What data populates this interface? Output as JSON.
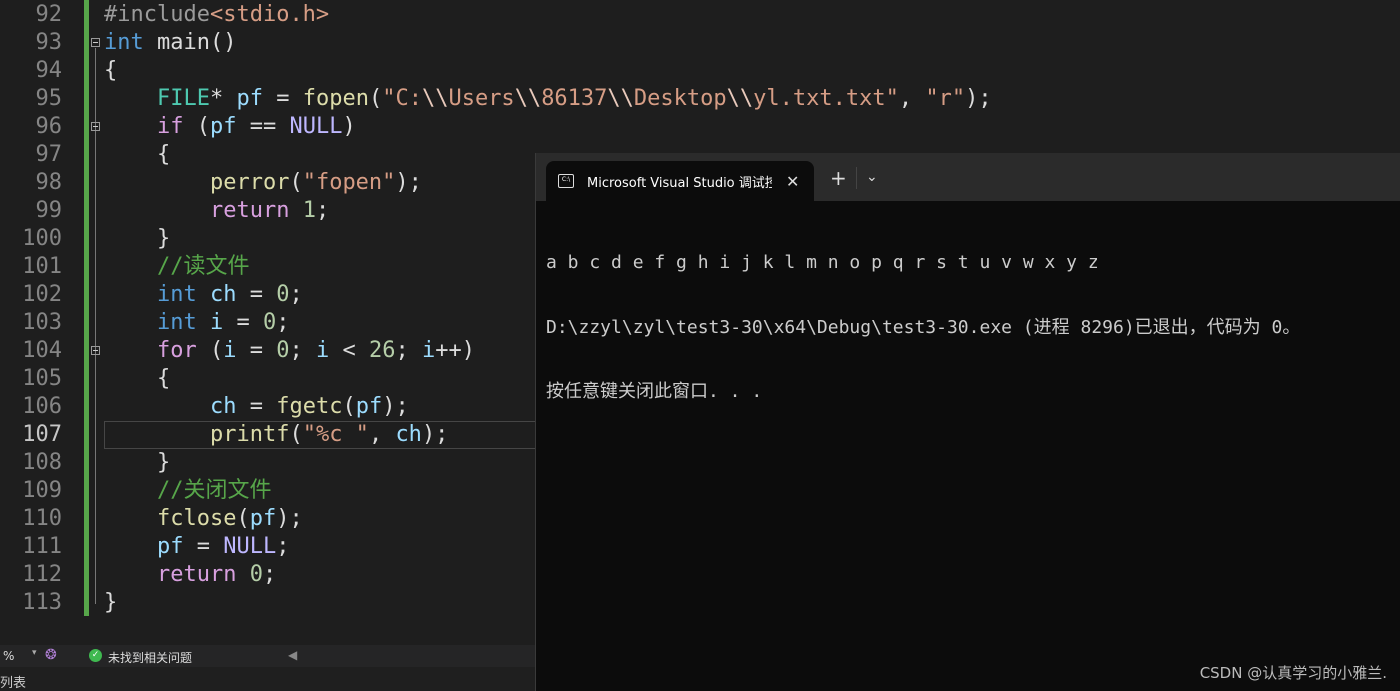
{
  "editor": {
    "current_line": 107,
    "lines": [
      {
        "n": 92,
        "tokens": [
          [
            "#include",
            "pp"
          ],
          [
            "<stdio.h>",
            "str"
          ]
        ]
      },
      {
        "n": 93,
        "tokens": [
          [
            "int",
            "kw"
          ],
          [
            " main()",
            ""
          ]
        ]
      },
      {
        "n": 94,
        "tokens": [
          [
            "{",
            ""
          ]
        ]
      },
      {
        "n": 95,
        "tokens": [
          [
            "    ",
            ""
          ],
          [
            "FILE",
            "ty"
          ],
          [
            "* ",
            ""
          ],
          [
            "pf",
            "var"
          ],
          [
            " = ",
            ""
          ],
          [
            "fopen",
            "fn"
          ],
          [
            "(",
            ""
          ],
          [
            "\"C:",
            "str"
          ],
          [
            "\\\\",
            "esc"
          ],
          [
            "Users",
            "str"
          ],
          [
            "\\\\",
            "esc"
          ],
          [
            "86137",
            "str"
          ],
          [
            "\\\\",
            "esc"
          ],
          [
            "Desktop",
            "str"
          ],
          [
            "\\\\",
            "esc"
          ],
          [
            "yl.txt.txt\"",
            "str"
          ],
          [
            ", ",
            ""
          ],
          [
            "\"r\"",
            "str"
          ],
          [
            ");",
            ""
          ]
        ]
      },
      {
        "n": 96,
        "tokens": [
          [
            "    ",
            ""
          ],
          [
            "if",
            "ctl"
          ],
          [
            " (",
            ""
          ],
          [
            "pf",
            "var"
          ],
          [
            " == ",
            ""
          ],
          [
            "NULL",
            "mac"
          ],
          [
            ")",
            ""
          ]
        ]
      },
      {
        "n": 97,
        "tokens": [
          [
            "    {",
            ""
          ]
        ]
      },
      {
        "n": 98,
        "tokens": [
          [
            "        ",
            ""
          ],
          [
            "perror",
            "fn"
          ],
          [
            "(",
            ""
          ],
          [
            "\"fopen\"",
            "str"
          ],
          [
            ");",
            ""
          ]
        ]
      },
      {
        "n": 99,
        "tokens": [
          [
            "        ",
            ""
          ],
          [
            "return",
            "ctl"
          ],
          [
            " ",
            ""
          ],
          [
            "1",
            "num"
          ],
          [
            ";",
            ""
          ]
        ]
      },
      {
        "n": 100,
        "tokens": [
          [
            "    }",
            ""
          ]
        ]
      },
      {
        "n": 101,
        "tokens": [
          [
            "    ",
            ""
          ],
          [
            "//读文件",
            "cm"
          ]
        ]
      },
      {
        "n": 102,
        "tokens": [
          [
            "    ",
            ""
          ],
          [
            "int",
            "kw"
          ],
          [
            " ",
            ""
          ],
          [
            "ch",
            "var"
          ],
          [
            " = ",
            ""
          ],
          [
            "0",
            "num"
          ],
          [
            ";",
            ""
          ]
        ]
      },
      {
        "n": 103,
        "tokens": [
          [
            "    ",
            ""
          ],
          [
            "int",
            "kw"
          ],
          [
            " ",
            ""
          ],
          [
            "i",
            "var"
          ],
          [
            " = ",
            ""
          ],
          [
            "0",
            "num"
          ],
          [
            ";",
            ""
          ]
        ]
      },
      {
        "n": 104,
        "tokens": [
          [
            "    ",
            ""
          ],
          [
            "for",
            "ctl"
          ],
          [
            " (",
            ""
          ],
          [
            "i",
            "var"
          ],
          [
            " = ",
            ""
          ],
          [
            "0",
            "num"
          ],
          [
            "; ",
            ""
          ],
          [
            "i",
            "var"
          ],
          [
            " < ",
            ""
          ],
          [
            "26",
            "num"
          ],
          [
            "; ",
            ""
          ],
          [
            "i",
            "var"
          ],
          [
            "++)",
            ""
          ]
        ]
      },
      {
        "n": 105,
        "tokens": [
          [
            "    {",
            ""
          ]
        ]
      },
      {
        "n": 106,
        "tokens": [
          [
            "        ",
            ""
          ],
          [
            "ch",
            "var"
          ],
          [
            " = ",
            ""
          ],
          [
            "fgetc",
            "fn"
          ],
          [
            "(",
            ""
          ],
          [
            "pf",
            "var"
          ],
          [
            ");",
            ""
          ]
        ]
      },
      {
        "n": 107,
        "tokens": [
          [
            "        ",
            ""
          ],
          [
            "printf",
            "fn"
          ],
          [
            "(",
            ""
          ],
          [
            "\"%c \"",
            "str"
          ],
          [
            ", ",
            ""
          ],
          [
            "ch",
            "var"
          ],
          [
            ");",
            ""
          ]
        ]
      },
      {
        "n": 108,
        "tokens": [
          [
            "    }",
            ""
          ]
        ]
      },
      {
        "n": 109,
        "tokens": [
          [
            "    ",
            ""
          ],
          [
            "//关闭文件",
            "cm"
          ]
        ]
      },
      {
        "n": 110,
        "tokens": [
          [
            "    ",
            ""
          ],
          [
            "fclose",
            "fn"
          ],
          [
            "(",
            ""
          ],
          [
            "pf",
            "var"
          ],
          [
            ");",
            ""
          ]
        ]
      },
      {
        "n": 111,
        "tokens": [
          [
            "    ",
            ""
          ],
          [
            "pf",
            "var"
          ],
          [
            " = ",
            ""
          ],
          [
            "NULL",
            "mac"
          ],
          [
            ";",
            ""
          ]
        ]
      },
      {
        "n": 112,
        "tokens": [
          [
            "    ",
            ""
          ],
          [
            "return",
            "ctl"
          ],
          [
            " ",
            ""
          ],
          [
            "0",
            "num"
          ],
          [
            ";",
            ""
          ]
        ]
      },
      {
        "n": 113,
        "tokens": [
          [
            "}",
            ""
          ]
        ]
      }
    ]
  },
  "status": {
    "zoom": "%",
    "issues": "未找到相关问题"
  },
  "bottom": {
    "label": "列表"
  },
  "console": {
    "tab_title": "Microsoft Visual Studio 调试\u0000",
    "tab_title_visible": "Microsoft Visual Studio 调试控",
    "new_tab": "+",
    "dropdown": "⌄",
    "output": [
      "a b c d e f g h i j k l m n o p q r s t u v w x y z",
      "D:\\zzyl\\zyl\\test3-30\\x64\\Debug\\test3-30.exe (进程 8296)已退出，代码为 0。",
      "按任意键关闭此窗口. . ."
    ]
  },
  "watermark": "CSDN @认真学习的小雅兰."
}
